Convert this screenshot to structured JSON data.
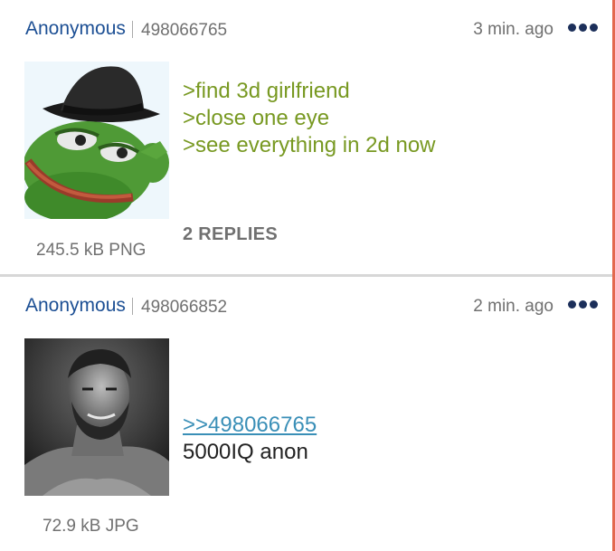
{
  "posts": [
    {
      "name": "Anonymous",
      "post_number": "498066765",
      "time_ago": "3 min. ago",
      "file_info": "245.5 kB PNG",
      "thumbnail_subject": "frog-with-fedora",
      "comment_lines": [
        ">find 3d girlfriend",
        ">close one eye",
        ">see everything in 2d now"
      ],
      "replies_label": "2 REPLIES"
    },
    {
      "name": "Anonymous",
      "post_number": "498066852",
      "time_ago": "2 min. ago",
      "file_info": "72.9 kB JPG",
      "thumbnail_subject": "muscular-man-grayscale",
      "quote_link": ">>498066765",
      "comment_text": "5000IQ anon"
    }
  ],
  "colors": {
    "name": "#1c4f94",
    "greentext": "#789922",
    "quote_link": "#3a8fb7",
    "meta_text": "#707070",
    "right_rule": "#e3694f",
    "divider": "#d7d7d7"
  },
  "icons": {
    "overflow_menu": "three-dots-icon"
  }
}
